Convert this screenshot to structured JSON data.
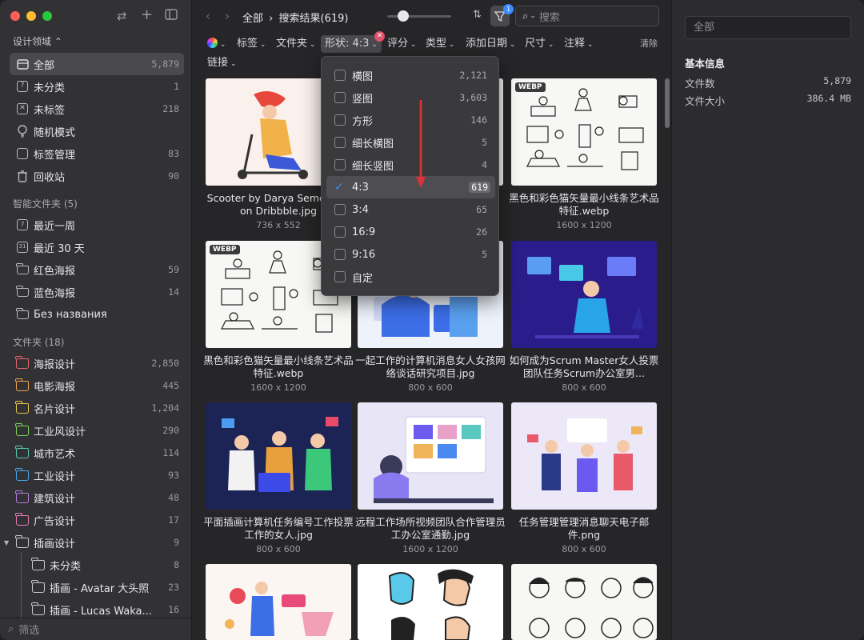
{
  "sidebar": {
    "library_title": "设计领域 ⌃",
    "main_items": [
      {
        "label": "全部",
        "count": "5,879"
      },
      {
        "label": "未分类",
        "count": "1"
      },
      {
        "label": "未标签",
        "count": "218"
      },
      {
        "label": "随机模式",
        "count": ""
      },
      {
        "label": "标签管理",
        "count": "83"
      },
      {
        "label": "回收站",
        "count": "90"
      }
    ],
    "smart_header": "智能文件夹 (5)",
    "smart_items": [
      {
        "label": "最近一周",
        "count": ""
      },
      {
        "label": "最近 30 天",
        "count": ""
      },
      {
        "label": "红色海报",
        "count": "59"
      },
      {
        "label": "蓝色海报",
        "count": "14"
      },
      {
        "label": "Без названия",
        "count": ""
      }
    ],
    "folders_header": "文件夹 (18)",
    "folders": [
      {
        "label": "海报设计",
        "count": "2,850",
        "color": "#e8646e"
      },
      {
        "label": "电影海报",
        "count": "445",
        "color": "#f0a24a"
      },
      {
        "label": "名片设计",
        "count": "1,204",
        "color": "#e8c64a"
      },
      {
        "label": "工业风设计",
        "count": "290",
        "color": "#7ad05a"
      },
      {
        "label": "城市艺术",
        "count": "114",
        "color": "#5ac8b4"
      },
      {
        "label": "工业设计",
        "count": "93",
        "color": "#4aa8e8"
      },
      {
        "label": "建筑设计",
        "count": "48",
        "color": "#b47ae0"
      },
      {
        "label": "广告设计",
        "count": "17",
        "color": "#e07ab8"
      },
      {
        "label": "插画设计",
        "count": "9",
        "color": "#c8c8cc"
      }
    ],
    "subfolders": [
      {
        "label": "未分类",
        "count": "8"
      },
      {
        "label": "插画 - Avatar 大头照",
        "count": "23"
      },
      {
        "label": "插画 - Lucas Waka...",
        "count": "16"
      }
    ],
    "filter_placeholder": "筛选"
  },
  "toolbar": {
    "crumb_root": "全部",
    "crumb_current": "搜索结果(619)",
    "filter_badge": "1",
    "search_placeholder": "搜索"
  },
  "filters": {
    "tags": "标签",
    "folder": "文件夹",
    "shape": "形状: 4:3",
    "rating": "评分",
    "type": "类型",
    "date": "添加日期",
    "size": "尺寸",
    "note": "注释",
    "clear": "清除",
    "link": "链接"
  },
  "grid": [
    {
      "caption": "Scooter by Darya Semenova on Dribbble.jpg",
      "dim": "736 x 552"
    },
    {
      "caption": "",
      "dim": ""
    },
    {
      "caption": "黑色和彩色猫矢量最小线条艺术品特征.webp",
      "dim": "1600 x 1200",
      "badge": "WEBP"
    },
    {
      "caption": "黑色和彩色猫矢量最小线条艺术品特征.webp",
      "dim": "1600 x 1200",
      "badge": "WEBP"
    },
    {
      "caption": "一起工作的计算机消息女人女孩网络谈话研究项目.jpg",
      "dim": "800 x 600"
    },
    {
      "caption": "如何成为Scrum Master女人投票团队任务Scrum办公室男...",
      "dim": "800 x 600"
    },
    {
      "caption": "平面插画计算机任务编号工作投票工作的女人.jpg",
      "dim": "800 x 600"
    },
    {
      "caption": "远程工作场所视频团队合作管理员工办公室通勤.jpg",
      "dim": "1600 x 1200"
    },
    {
      "caption": "任务管理管理消息聊天电子邮件.png",
      "dim": "800 x 600"
    }
  ],
  "shape_menu": [
    {
      "label": "横图",
      "count": "2,121",
      "checked": false
    },
    {
      "label": "竖图",
      "count": "3,603",
      "checked": false
    },
    {
      "label": "方形",
      "count": "146",
      "checked": false
    },
    {
      "label": "细长横图",
      "count": "5",
      "checked": false
    },
    {
      "label": "细长竖图",
      "count": "4",
      "checked": false
    },
    {
      "label": "4:3",
      "count": "619",
      "checked": true
    },
    {
      "label": "3:4",
      "count": "65",
      "checked": false
    },
    {
      "label": "16:9",
      "count": "26",
      "checked": false
    },
    {
      "label": "9:16",
      "count": "5",
      "checked": false
    },
    {
      "label": "自定",
      "count": "",
      "checked": false
    }
  ],
  "inspector": {
    "input_value": "全部",
    "section": "基本信息",
    "file_count_label": "文件数",
    "file_count": "5,879",
    "file_size_label": "文件大小",
    "file_size": "386.4 MB"
  }
}
